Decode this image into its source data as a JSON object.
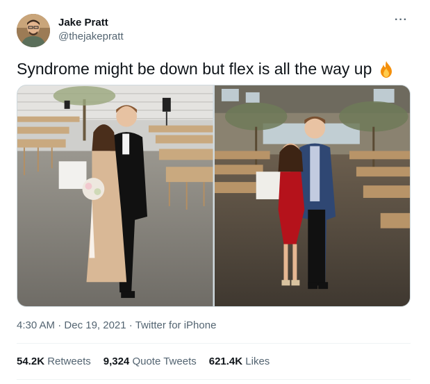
{
  "author": {
    "name": "Jake Pratt",
    "handle": "@thejakepratt",
    "avatar_icon": "avatar-photo"
  },
  "more_label": "···",
  "tweet": {
    "text": "Syndrome might be down but flex is all the way up",
    "emoji_icon": "fire-emoji"
  },
  "media": {
    "photos": [
      "photo-left",
      "photo-right"
    ]
  },
  "meta": {
    "time": "4:30 AM",
    "sep1": "·",
    "date": "Dec 19, 2021",
    "sep2": "·",
    "source": "Twitter for iPhone"
  },
  "stats": {
    "retweets_count": "54.2K",
    "retweets_label": "Retweets",
    "quotes_count": "9,324",
    "quotes_label": "Quote Tweets",
    "likes_count": "621.4K",
    "likes_label": "Likes"
  },
  "colors": {
    "text_primary": "#0f1419",
    "text_secondary": "#536471",
    "border": "#cfd9de"
  }
}
